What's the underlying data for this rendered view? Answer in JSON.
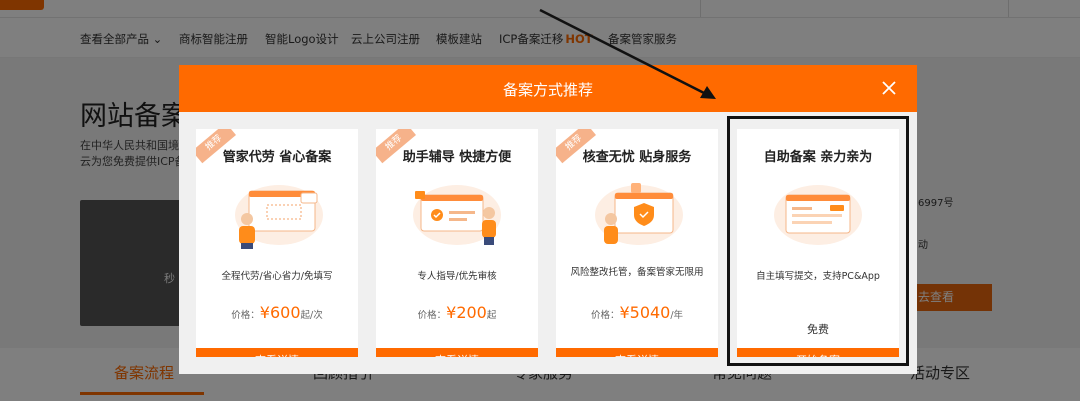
{
  "subnav": {
    "items": [
      "查看全部产品 ⌄",
      "商标智能注册",
      "智能Logo设计",
      "云上公司注册",
      "模板建站",
      "ICP备案迁移",
      "备案管家服务"
    ],
    "hot_badge": "HOT"
  },
  "hero": {
    "title": "网站备案",
    "desc_line1": "在中华人民共和国境",
    "desc_line2": "云为您免费提供ICP备",
    "video_text": "秒",
    "side_text1": "6997号",
    "side_text2": "动",
    "side_button": "去查看"
  },
  "tabs": [
    "备案流程",
    "回顾指引",
    "专家服务",
    "常见问题",
    "活动专区"
  ],
  "modal": {
    "title": "备案方式推荐",
    "cards": [
      {
        "ribbon": "推荐",
        "title": "管家代劳 省心备案",
        "desc": "全程代劳/省心省力/免填写",
        "price_label": "价格：",
        "price": "¥600",
        "price_unit": "起/次",
        "button": "查看详情"
      },
      {
        "ribbon": "推荐",
        "title": "助手辅导 快捷方便",
        "desc": "专人指导/优先审核",
        "price_label": "价格：",
        "price": "¥200",
        "price_unit": "起",
        "button": "查看详情"
      },
      {
        "ribbon": "推荐",
        "title": "核查无忧 贴身服务",
        "desc": "风险整改托管，备案管家无限用",
        "price_label": "价格：",
        "price": "¥5040",
        "price_unit": "/年",
        "button": "查看详情"
      },
      {
        "title": "自助备案 亲力亲为",
        "desc": "自主填写提交，支持PC&App",
        "free_label": "免费",
        "button": "开始备案"
      }
    ]
  },
  "colors": {
    "accent": "#ff6a00",
    "overlay": "rgba(0,0,0,0.5)"
  }
}
